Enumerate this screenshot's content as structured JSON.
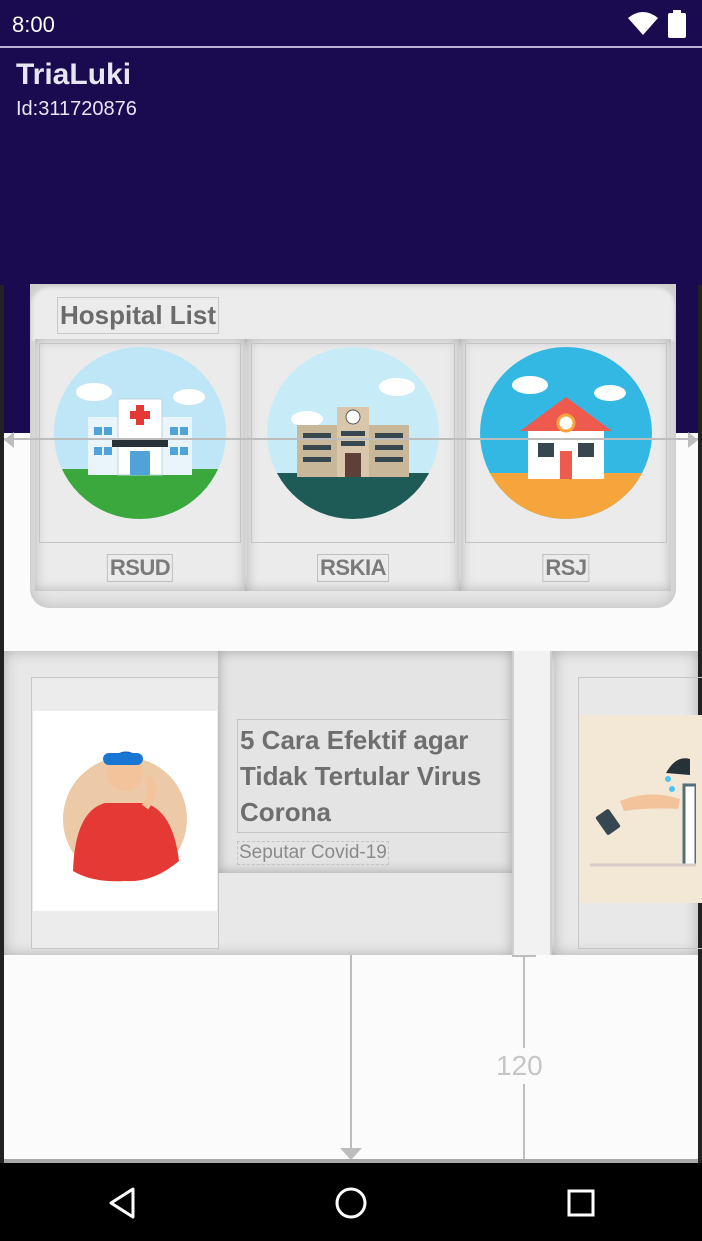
{
  "status_bar": {
    "time": "8:00",
    "wifi_icon": "wifi-icon",
    "battery_icon": "battery-icon"
  },
  "header": {
    "name": "TriaLuki",
    "id_text": "Id:311720876"
  },
  "hospital": {
    "title": "Hospital List",
    "items": [
      {
        "label": "RSUD",
        "icon": "hospital-building-icon"
      },
      {
        "label": "RSKIA",
        "icon": "clinic-building-icon"
      },
      {
        "label": "RSJ",
        "icon": "house-building-icon"
      }
    ]
  },
  "news": [
    {
      "title": "5 Cara Efektif agar Tidak Tertular Virus Corona",
      "category": "Seputar Covid-19",
      "icon": "coughing-person-illustration"
    },
    {
      "icon": "hand-sanitizer-illustration"
    }
  ],
  "design_guides": {
    "margin_label": "120"
  },
  "nav_bar": {
    "back_icon": "back-icon",
    "home_icon": "home-icon",
    "recents_icon": "recents-icon"
  },
  "colors": {
    "primary": "#1a0a4f",
    "card": "#e6e6e6",
    "text_gray": "#6e6e6e"
  }
}
